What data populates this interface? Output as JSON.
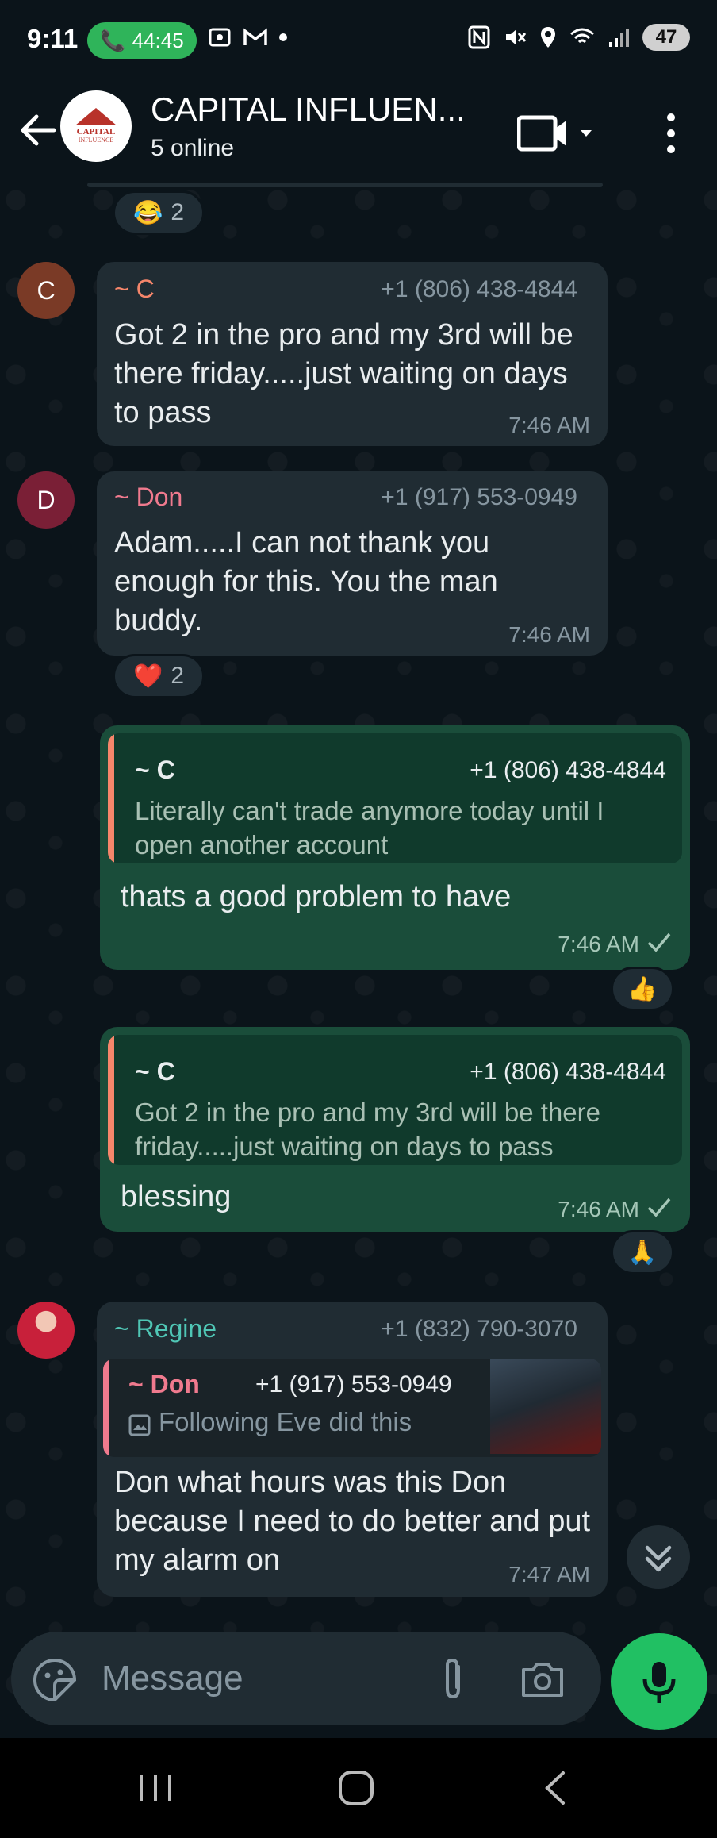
{
  "status_bar": {
    "time": "9:11",
    "call_duration": "44:45",
    "battery": "47"
  },
  "header": {
    "title": "CAPITAL INFLUEN...",
    "subtitle": "5 online",
    "avatar_line1": "CAPITAL",
    "avatar_line2": "INFLUENCE"
  },
  "messages": [
    {
      "reaction": {
        "emoji": "😂",
        "count": "2"
      }
    },
    {
      "avatar_letter": "C",
      "sender": "~ C",
      "phone": "+1 (806) 438-4844",
      "text": "Got 2 in the pro and my 3rd will be there friday.....just waiting on days to pass",
      "time": "7:46 AM"
    },
    {
      "avatar_letter": "D",
      "sender": "~ Don",
      "phone": "+1 (917) 553-0949",
      "text": "Adam.....I can not thank you enough for this. You the man buddy.",
      "time": "7:46 AM",
      "reaction": {
        "emoji": "❤️",
        "count": "2"
      }
    },
    {
      "quote_sender": "~ C",
      "quote_phone": "+1 (806) 438-4844",
      "quote_text": "Literally can't trade anymore today until I open another account",
      "text": "thats a good problem to have",
      "time": "7:46 AM",
      "reaction": {
        "emoji": "👍"
      }
    },
    {
      "quote_sender": "~ C",
      "quote_phone": "+1 (806) 438-4844",
      "quote_text": "Got 2 in the pro and my 3rd will be there friday.....just waiting on days to pass",
      "text": "blessing",
      "time": "7:46 AM",
      "reaction": {
        "emoji": "🙏"
      }
    },
    {
      "sender": "~ Regine",
      "phone": "+1 (832) 790-3070",
      "quote_sender": "~ Don",
      "quote_phone": "+1 (917) 553-0949",
      "quote_text": "Following Eve did this",
      "text": "Don what hours was this Don because  I need to do better and put my alarm on",
      "time": "7:47 AM"
    }
  ],
  "composer": {
    "placeholder": "Message"
  },
  "colors": {
    "sender_c": "#f5866b",
    "sender_don": "#f07a8e",
    "sender_regine": "#4fc6b5",
    "avatar_c": "#7a3a26",
    "avatar_d": "#7a1f36",
    "accent_green": "#21c063"
  }
}
